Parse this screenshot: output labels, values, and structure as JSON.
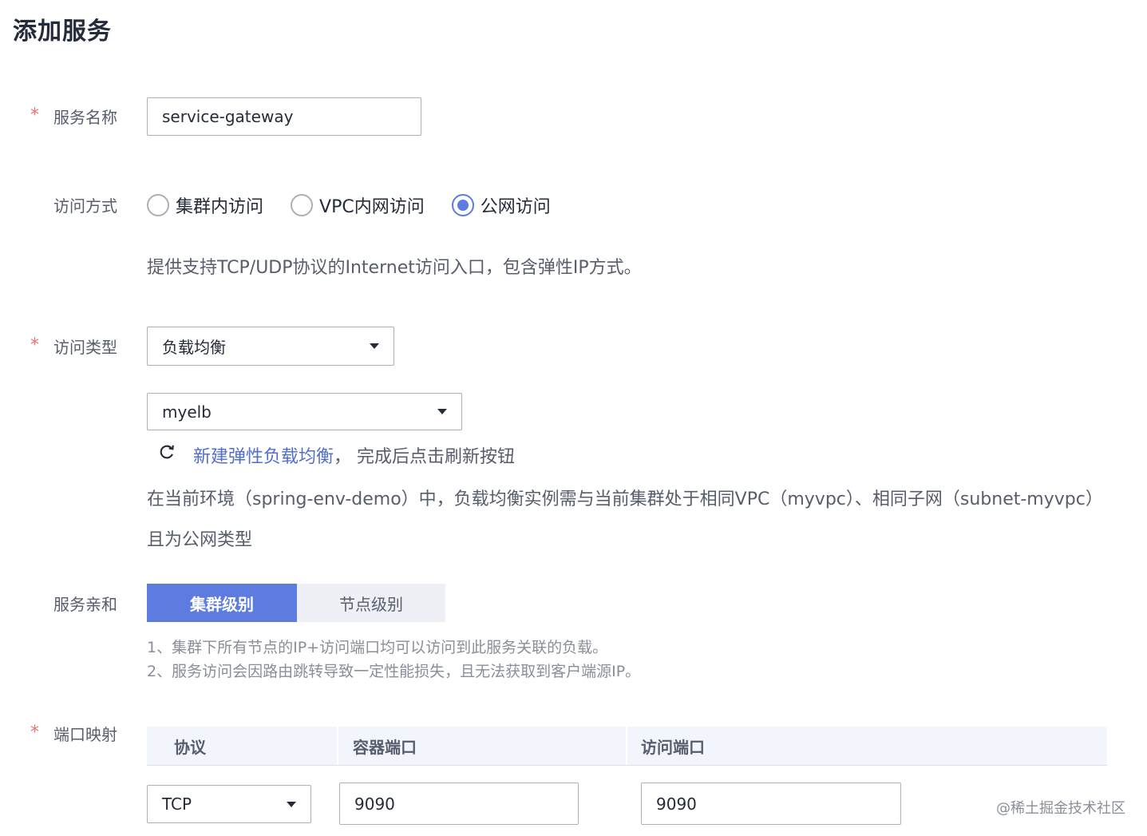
{
  "page": {
    "title": "添加服务"
  },
  "required_mark": "*",
  "service_name": {
    "label": "服务名称",
    "value": "service-gateway"
  },
  "access_mode": {
    "label": "访问方式",
    "options": [
      "集群内访问",
      "VPC内网访问",
      "公网访问"
    ],
    "selected": "公网访问",
    "description": "提供支持TCP/UDP协议的Internet访问入口，包含弹性IP方式。"
  },
  "access_type": {
    "label": "访问类型",
    "value": "负载均衡",
    "elb_value": "myelb",
    "create_link": "新建弹性负载均衡",
    "refresh_hint": "，  完成后点击刷新按钮",
    "note_line1": "在当前环境（spring-env-demo）中，负载均衡实例需与当前集群处于相同VPC（myvpc）、相同子网（subnet-myvpc）",
    "note_line2": "且为公网类型"
  },
  "affinity": {
    "label": "服务亲和",
    "options": [
      "集群级别",
      "节点级别"
    ],
    "selected": "集群级别",
    "hint1": "1、集群下所有节点的IP+访问端口均可以访问到此服务关联的负载。",
    "hint2": "2、服务访问会因路由跳转导致一定性能损失，且无法获取到客户端源IP。"
  },
  "port_mapping": {
    "label": "端口映射",
    "columns": [
      "协议",
      "容器端口",
      "访问端口"
    ],
    "row": {
      "protocol": "TCP",
      "container_port": "9090",
      "access_port": "9090"
    }
  },
  "watermark": "@稀土掘金技术社区",
  "colors": {
    "primary": "#5e7ce0",
    "link": "#526ecc",
    "required": "#f66f6a"
  }
}
